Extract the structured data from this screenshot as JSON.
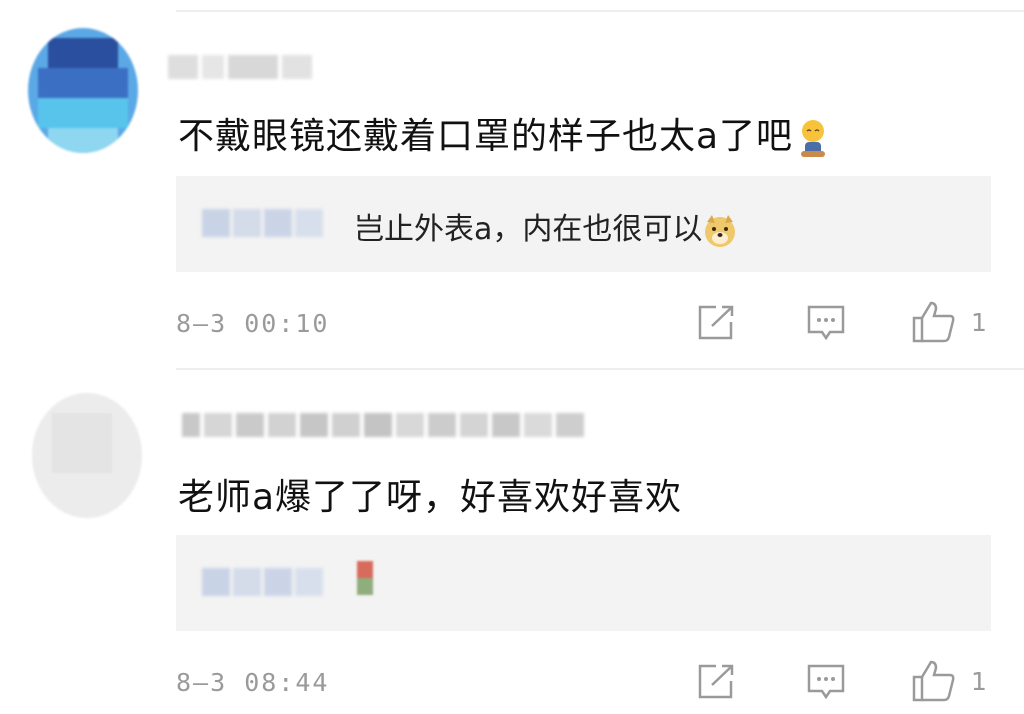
{
  "comments": [
    {
      "text": "不戴眼镜还戴着口罩的样子也太a了吧",
      "emoji": "person-emoji",
      "reply": {
        "text": "岂止外表a，内在也很可以",
        "emoji": "doge-emoji"
      },
      "timestamp": "8—3 00:10",
      "likes": "1"
    },
    {
      "text": "老师a爆了了呀，好喜欢好喜欢",
      "reply": {
        "text": ""
      },
      "timestamp": "8—3 08:44",
      "likes": "1"
    }
  ],
  "colors": {
    "text": "#111111",
    "meta": "#9a9a9a",
    "reply_bg": "#f3f3f3",
    "divider": "#eeeeee"
  }
}
